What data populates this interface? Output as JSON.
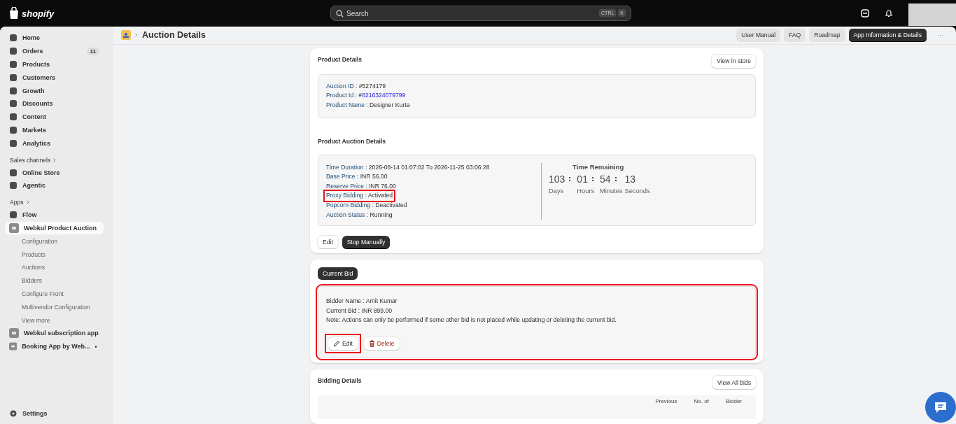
{
  "topbar": {
    "logo": "shopify",
    "search": {
      "placeholder": "Search",
      "shortcut": [
        "CTRL",
        "K"
      ]
    }
  },
  "sidebar": {
    "items": [
      {
        "kind": "main",
        "label": "Home",
        "selected": false
      },
      {
        "kind": "main",
        "label": "Orders",
        "badge": "11",
        "selected": false
      },
      {
        "kind": "main",
        "label": "Products",
        "selected": false
      },
      {
        "kind": "main",
        "label": "Customers",
        "selected": false
      },
      {
        "kind": "main",
        "label": "Growth",
        "selected": false
      },
      {
        "kind": "main",
        "label": "Discounts",
        "selected": false
      },
      {
        "kind": "main",
        "label": "Content",
        "selected": false
      },
      {
        "kind": "main",
        "label": "Markets",
        "selected": false
      },
      {
        "kind": "main",
        "label": "Analytics",
        "selected": false
      },
      {
        "kind": "section",
        "label": "Sales channels"
      },
      {
        "kind": "main",
        "label": "Online Store",
        "selected": false
      },
      {
        "kind": "main",
        "label": "Agentic",
        "selected": false
      },
      {
        "kind": "section",
        "label": "Apps"
      },
      {
        "kind": "main",
        "label": "Flow",
        "selected": false
      },
      {
        "kind": "app",
        "label": "Webkul Product Auction",
        "selected": true
      },
      {
        "kind": "sub",
        "label": "Configuration",
        "selected": false
      },
      {
        "kind": "sub",
        "label": "Products",
        "selected": false
      },
      {
        "kind": "sub",
        "label": "Auctions",
        "selected": false
      },
      {
        "kind": "sub",
        "label": "Bidders",
        "selected": false
      },
      {
        "kind": "sub",
        "label": "Configure Front",
        "selected": false
      },
      {
        "kind": "sub",
        "label": "Multivendor Configuration",
        "selected": false
      },
      {
        "kind": "sub",
        "label": "View more",
        "selected": false
      },
      {
        "kind": "app",
        "label": "Webkul subscription app",
        "selected": false
      },
      {
        "kind": "app",
        "label": "Booking App by Web...",
        "selected": false,
        "dot": true
      }
    ],
    "settings": "Settings"
  },
  "header": {
    "breadcrumb": "Auction Details",
    "buttons": [
      {
        "label": "User Manual",
        "primary": false
      },
      {
        "label": "FAQ",
        "primary": false
      },
      {
        "label": "Roadmap",
        "primary": false
      },
      {
        "label": "App Information & Details",
        "primary": true
      }
    ],
    "more": "···"
  },
  "product_details": {
    "title": "Product Details",
    "action": "View in store",
    "fields": [
      {
        "label": "Auction ID :",
        "value": "#5274179",
        "link": false
      },
      {
        "label": "Product Id :",
        "prefix": "#",
        "value": "8216324079799",
        "link": true
      },
      {
        "label": "Product Name :",
        "value": "Designer Kurta",
        "link": false
      }
    ]
  },
  "auction_details": {
    "title": "Product Auction Details",
    "fields": [
      {
        "label": "Time Duration :",
        "value": "2026-08-14 01:07:02 To 2026-11-25 03:06:28",
        "highlighted": false
      },
      {
        "label": "Base Price :",
        "value": "INR 56.00",
        "highlighted": false
      },
      {
        "label": "Reserve Price :",
        "value": "INR 76.00",
        "highlighted": false
      },
      {
        "label": "Proxy Bidding :",
        "value": "Activated",
        "highlighted": true
      },
      {
        "label": "Popcorn Bidding :",
        "value": "Deactivated",
        "highlighted": false
      },
      {
        "label": "Auction Status :",
        "value": "Running",
        "highlighted": false
      }
    ],
    "countdown": {
      "title": "Time Remaining",
      "units": [
        {
          "value": "103",
          "label": "Days"
        },
        {
          "value": "01",
          "label": "Hours"
        },
        {
          "value": "54",
          "label": "Minutes"
        },
        {
          "value": "13",
          "label": "Seconds"
        }
      ]
    },
    "buttons": [
      {
        "label": "Edit",
        "primary": false
      },
      {
        "label": "Stop Manually",
        "primary": true
      }
    ]
  },
  "current_bid": {
    "tab": "Current Bid",
    "highlighted": true,
    "lines": [
      "Bidder Name : Amit Kumar",
      "Current Bid : INR 899.00",
      "Note: Actions can only be performed if some other bid is not placed while updating or deleting the current bid."
    ],
    "edit": {
      "label": "Edit",
      "highlighted": true
    },
    "delete": "Delete"
  },
  "bidding_details": {
    "title": "Bidding Details",
    "action": "View All bids",
    "columns": [
      "Previous",
      "No. of",
      "Bidder"
    ]
  }
}
